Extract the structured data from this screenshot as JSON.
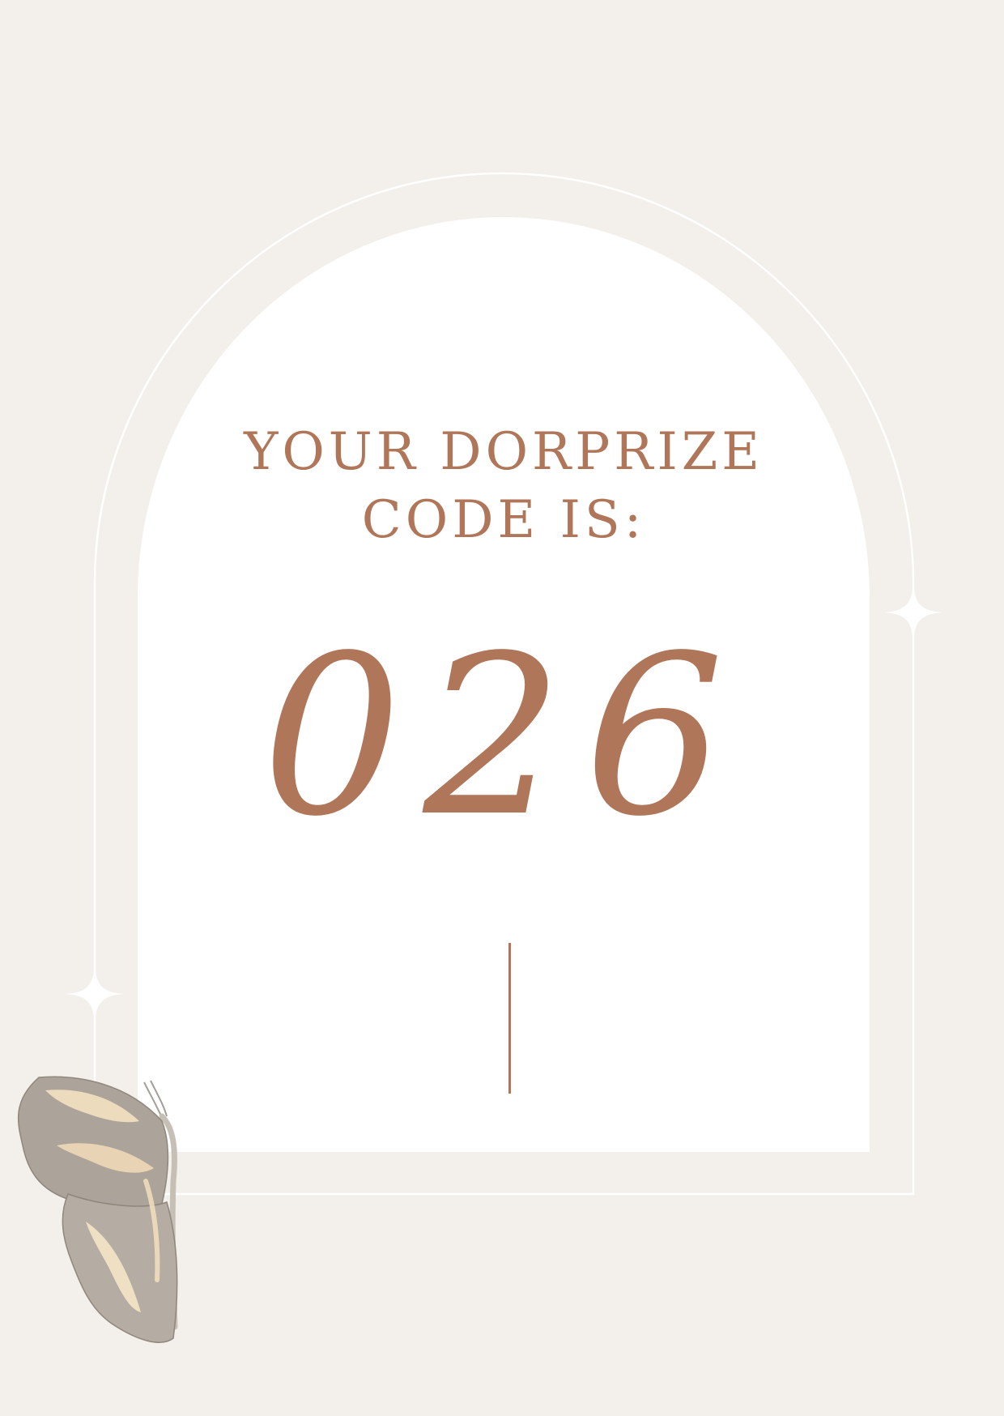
{
  "heading": {
    "line1": "YOUR DORPRIZE",
    "line2": "CODE IS:"
  },
  "code": {
    "value": "026"
  },
  "colors": {
    "background": "#f3f0eb",
    "panel": "#ffffff",
    "accent": "#b07659",
    "outline": "#ffffff"
  },
  "icons": {
    "right_sparkle": "four-point-star-icon",
    "left_sparkle": "four-point-star-icon",
    "moth": "moth-illustration"
  }
}
